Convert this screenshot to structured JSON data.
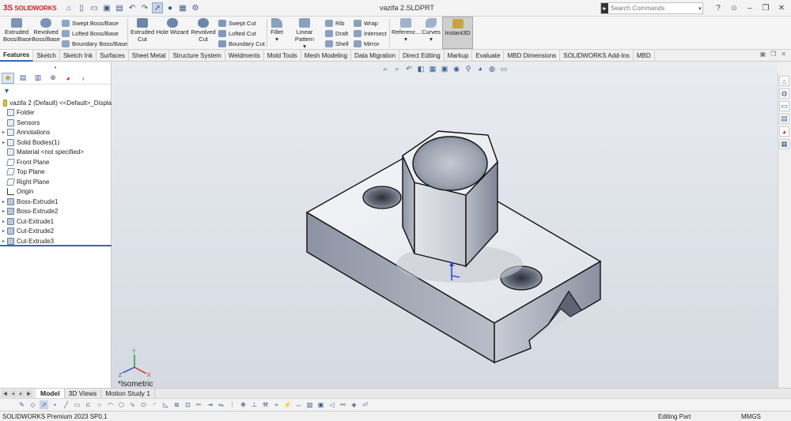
{
  "app": {
    "brand_prefix": "3S",
    "brand_name": "SOLIDWORKS",
    "doc_title": "vazifa 2.SLDPRT"
  },
  "search": {
    "placeholder": "Search Commands"
  },
  "ribbon": {
    "extruded_boss": [
      "Extruded",
      "Boss/Base"
    ],
    "revolved_boss": [
      "Revolved",
      "Boss/Base"
    ],
    "swept_boss": "Swept Boss/Base",
    "lofted_boss": "Lofted Boss/Base",
    "boundary_boss": "Boundary Boss/Base",
    "extruded_cut": [
      "Extruded",
      "Cut"
    ],
    "hole_wizard": "Hole Wizard",
    "revolved_cut": [
      "Revolved",
      "Cut"
    ],
    "swept_cut": "Swept Cut",
    "lofted_cut": "Lofted Cut",
    "boundary_cut": "Boundary Cut",
    "fillet": "Fillet",
    "linear_pattern": "Linear Pattern",
    "rib": "Rib",
    "wrap": "Wrap",
    "draft": "Draft",
    "intersect": "Intersect",
    "shell": "Shell",
    "mirror": "Mirror",
    "reference": "Referenc...",
    "curves": "Curves",
    "instant3d": "Instant3D"
  },
  "tabs": [
    "Features",
    "Sketch",
    "Sketch Ink",
    "Surfaces",
    "Sheet Metal",
    "Structure System",
    "Weldments",
    "Mold Tools",
    "Mesh Modeling",
    "Data Migration",
    "Direct Editing",
    "Markup",
    "Evaluate",
    "MBD Dimensions",
    "SOLIDWORKS Add-Ins",
    "MBD"
  ],
  "active_tab": "Features",
  "tree": {
    "root": "vazifa 2 (Default) <<Default>_Displa",
    "items": [
      {
        "label": "Folder",
        "kind": "folder",
        "expandable": false
      },
      {
        "label": "Sensors",
        "kind": "sensor",
        "expandable": false
      },
      {
        "label": "Annotations",
        "kind": "annotation",
        "expandable": true
      },
      {
        "label": "Solid Bodies(1)",
        "kind": "body",
        "expandable": true
      },
      {
        "label": "Material <not specified>",
        "kind": "material",
        "expandable": false
      },
      {
        "label": "Front Plane",
        "kind": "plane",
        "expandable": false
      },
      {
        "label": "Top Plane",
        "kind": "plane",
        "expandable": false
      },
      {
        "label": "Right Plane",
        "kind": "plane",
        "expandable": false
      },
      {
        "label": "Origin",
        "kind": "origin",
        "expandable": false
      },
      {
        "label": "Boss-Extrude1",
        "kind": "feat",
        "expandable": true
      },
      {
        "label": "Boss-Extrude2",
        "kind": "feat",
        "expandable": true
      },
      {
        "label": "Cut-Extrude1",
        "kind": "feat",
        "expandable": true
      },
      {
        "label": "Cut-Extrude2",
        "kind": "feat",
        "expandable": true
      },
      {
        "label": "Cut-Extrude3",
        "kind": "feat",
        "expandable": true
      }
    ]
  },
  "viewport": {
    "view_label": "*Isometric"
  },
  "bottom_tabs": [
    "Model",
    "3D Views",
    "Motion Study 1"
  ],
  "active_bottom_tab": "Model",
  "status": {
    "product": "SOLIDWORKS Premium 2023 SP0.1",
    "mode": "Editing Part",
    "units": "MMGS"
  }
}
